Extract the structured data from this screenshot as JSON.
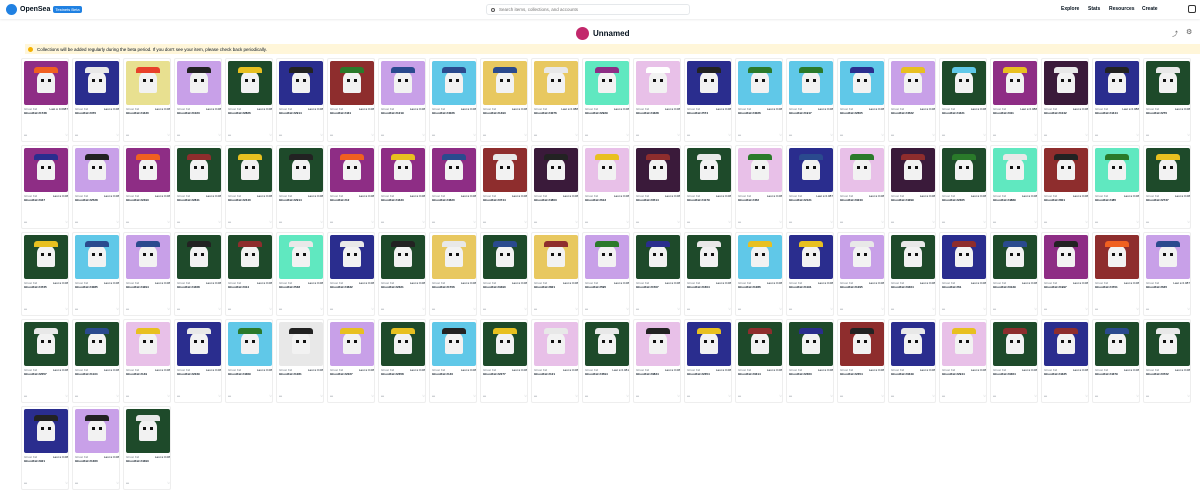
{
  "topbar": {
    "logo_text": "OpenSea",
    "beta_badge": "Testnets Beta",
    "search_placeholder": "Search items, collections, and accounts",
    "nav": [
      "Explore",
      "Stats",
      "Resources",
      "Create"
    ]
  },
  "collection": {
    "name": "Unnamed"
  },
  "notice": "Collections will be added regularly during the beta period. If you don't see your item, please check back periodically.",
  "card_label": "Ghost Kid",
  "card_price_prefix": "Last",
  "items": [
    {
      "id": "#1738",
      "price": "0.0987",
      "bg": "#8e2d85",
      "hat": "#f06020"
    },
    {
      "id": "#370",
      "price": "0.08",
      "bg": "#2a2d8e",
      "hat": "#e8e8e8"
    },
    {
      "id": "#4430",
      "price": "0.08",
      "bg": "#e8e090",
      "hat": "#e8402a"
    },
    {
      "id": "#1023",
      "price": "0.08",
      "bg": "#c8a0e8",
      "hat": "#222222"
    },
    {
      "id": "#2826",
      "price": "0.08",
      "bg": "#1e4a2a",
      "hat": "#e8c020"
    },
    {
      "id": "#2914",
      "price": "0.08",
      "bg": "#2a2d8e",
      "hat": "#222222"
    },
    {
      "id": "#431",
      "price": "0.08",
      "bg": "#8e2d2d",
      "hat": "#2a7a2a"
    },
    {
      "id": "#1219",
      "price": "0.08",
      "bg": "#c8a0e8",
      "hat": "#2a4a8e"
    },
    {
      "id": "#4026",
      "price": "0.08",
      "bg": "#60c8e8",
      "hat": "#2a4a8e"
    },
    {
      "id": "#1493",
      "price": "0.08",
      "bg": "#e8c860",
      "hat": "#2a4a8e"
    },
    {
      "id": "#4076",
      "price": "0.088",
      "bg": "#e8c860",
      "hat": "#e8e8e8"
    },
    {
      "id": "#2929",
      "price": "0.08",
      "bg": "#60e8c0",
      "hat": "#8e2d85"
    },
    {
      "id": "#4328",
      "price": "0.08",
      "bg": "#e8c0e8",
      "hat": "#ffffff"
    },
    {
      "id": "#574",
      "price": "0.08",
      "bg": "#2a2d8e",
      "hat": "#222222"
    },
    {
      "id": "#4026",
      "price": "0.08",
      "bg": "#60c8e8",
      "hat": "#2a7a2a"
    },
    {
      "id": "#1917",
      "price": "0.08",
      "bg": "#60c8e8",
      "hat": "#2a7a2a"
    },
    {
      "id": "#2605",
      "price": "0.08",
      "bg": "#60c8e8",
      "hat": "#2a2d8e"
    },
    {
      "id": "#4522",
      "price": "0.08",
      "bg": "#c8a0e8",
      "hat": "#e8c020"
    },
    {
      "id": "#4421",
      "price": "0.08",
      "bg": "#1e4a2a",
      "hat": "#60c8e8"
    },
    {
      "id": "#311",
      "price": "0.088",
      "bg": "#8e2d85",
      "hat": "#e8c020"
    },
    {
      "id": "#1042",
      "price": "0.08",
      "bg": "#3a1a3a",
      "hat": "#e8e8e8"
    },
    {
      "id": "#4444",
      "price": "0.088",
      "bg": "#2a2d8e",
      "hat": "#222222"
    },
    {
      "id": "#270",
      "price": "0.08",
      "bg": "#1e4a2a",
      "hat": "#e8e8e8"
    },
    {
      "id": "#347",
      "price": "0.08",
      "bg": "#8e2d85",
      "hat": "#2a2d8e"
    },
    {
      "id": "#2528",
      "price": "0.08",
      "bg": "#c8a0e8",
      "hat": "#222222"
    },
    {
      "id": "#2493",
      "price": "0.08",
      "bg": "#8e2d85",
      "hat": "#f06020"
    },
    {
      "id": "#2841",
      "price": "0.08",
      "bg": "#1e4a2a",
      "hat": "#8e2d2d"
    },
    {
      "id": "#2440",
      "price": "0.08",
      "bg": "#1e4a2a",
      "hat": "#e8c020"
    },
    {
      "id": "#2914",
      "price": "0.08",
      "bg": "#1e4a2a",
      "hat": "#222222"
    },
    {
      "id": "#12",
      "price": "0.08",
      "bg": "#8e2d85",
      "hat": "#f06020"
    },
    {
      "id": "#4433",
      "price": "0.08",
      "bg": "#8e2d85",
      "hat": "#e8c020"
    },
    {
      "id": "#4620",
      "price": "0.08",
      "bg": "#8e2d85",
      "hat": "#2a4a8e"
    },
    {
      "id": "#3744",
      "price": "0.08",
      "bg": "#8e2d2d",
      "hat": "#e8e8e8"
    },
    {
      "id": "#4803",
      "price": "0.08",
      "bg": "#3a1a3a",
      "hat": "#222222"
    },
    {
      "id": "#613",
      "price": "0.08",
      "bg": "#e8c0e8",
      "hat": "#e8c020"
    },
    {
      "id": "#3514",
      "price": "0.08",
      "bg": "#3a1a3a",
      "hat": "#8e2d2d"
    },
    {
      "id": "#4179",
      "price": "0.08",
      "bg": "#1e4a2a",
      "hat": "#e8e8e8"
    },
    {
      "id": "#452",
      "price": "0.08",
      "bg": "#e8c0e8",
      "hat": "#2a7a2a"
    },
    {
      "id": "#2121",
      "price": "0.087",
      "bg": "#2a2d8e",
      "hat": "#2a4a8e"
    },
    {
      "id": "#3243",
      "price": "0.08",
      "bg": "#e8c0e8",
      "hat": "#2a7a2a"
    },
    {
      "id": "#4299",
      "price": "0.08",
      "bg": "#3a1a3a",
      "hat": "#8e2d2d"
    },
    {
      "id": "#2365",
      "price": "0.08",
      "bg": "#1e4a2a",
      "hat": "#2a7a2a"
    },
    {
      "id": "#4889",
      "price": "0.08",
      "bg": "#60e8c0",
      "hat": "#e8e8e8"
    },
    {
      "id": "#801",
      "price": "0.08",
      "bg": "#8e2d2d",
      "hat": "#222222"
    },
    {
      "id": "#485",
      "price": "0.08",
      "bg": "#60e8c0",
      "hat": "#2a7a2a"
    },
    {
      "id": "#2737",
      "price": "0.08",
      "bg": "#1e4a2a",
      "hat": "#e8c020"
    },
    {
      "id": "#4735",
      "price": "0.08",
      "bg": "#1e4a2a",
      "hat": "#e8c020"
    },
    {
      "id": "#4085",
      "price": "0.08",
      "bg": "#60c8e8",
      "hat": "#2a4a8e"
    },
    {
      "id": "#4294",
      "price": "0.08",
      "bg": "#c8a0e8",
      "hat": "#2a4a8e"
    },
    {
      "id": "#4468",
      "price": "0.08",
      "bg": "#1e4a2a",
      "hat": "#222222"
    },
    {
      "id": "#314",
      "price": "0.08",
      "bg": "#1e4a2a",
      "hat": "#8e2d2d"
    },
    {
      "id": "#548",
      "price": "0.08",
      "bg": "#60e8c0",
      "hat": "#e8e8e8"
    },
    {
      "id": "#4632",
      "price": "0.08",
      "bg": "#2a2d8e",
      "hat": "#e8e8e8"
    },
    {
      "id": "#2321",
      "price": "0.08",
      "bg": "#1e4a2a",
      "hat": "#222222"
    },
    {
      "id": "#1706",
      "price": "0.08",
      "bg": "#e8c860",
      "hat": "#e8e8e8"
    },
    {
      "id": "#3490",
      "price": "0.08",
      "bg": "#1e4a2a",
      "hat": "#2a4a8e"
    },
    {
      "id": "#821",
      "price": "0.08",
      "bg": "#e8c860",
      "hat": "#8e2d2d"
    },
    {
      "id": "#595",
      "price": "0.08",
      "bg": "#c8a0e8",
      "hat": "#2a7a2a"
    },
    {
      "id": "#1507",
      "price": "0.08",
      "bg": "#1e4a2a",
      "hat": "#2a2d8e"
    },
    {
      "id": "#1604",
      "price": "0.08",
      "bg": "#1e4a2a",
      "hat": "#e8e8e8"
    },
    {
      "id": "#1286",
      "price": "0.08",
      "bg": "#60c8e8",
      "hat": "#e8c020"
    },
    {
      "id": "#1191",
      "price": "0.08",
      "bg": "#2a2d8e",
      "hat": "#e8c020"
    },
    {
      "id": "#1295",
      "price": "0.08",
      "bg": "#c8a0e8",
      "hat": "#e8e8e8"
    },
    {
      "id": "#3464",
      "price": "0.08",
      "bg": "#1e4a2a",
      "hat": "#e8e8e8"
    },
    {
      "id": "#61",
      "price": "0.08",
      "bg": "#2a2d8e",
      "hat": "#8e2d2d"
    },
    {
      "id": "#3139",
      "price": "0.08",
      "bg": "#1e4a2a",
      "hat": "#2a4a8e"
    },
    {
      "id": "#1997",
      "price": "0.08",
      "bg": "#8e2d85",
      "hat": "#222222"
    },
    {
      "id": "#4701",
      "price": "0.08",
      "bg": "#8e2d2d",
      "hat": "#f06020"
    },
    {
      "id": "#645",
      "price": "0.087",
      "bg": "#c8a0e8",
      "hat": "#2a4a8e"
    },
    {
      "id": "#2057",
      "price": "0.08",
      "bg": "#1e4a2a",
      "hat": "#e8e8e8"
    },
    {
      "id": "#1134",
      "price": "0.08",
      "bg": "#1e4a2a",
      "hat": "#2a4a8e"
    },
    {
      "id": "#149",
      "price": "0.08",
      "bg": "#e8c0e8",
      "hat": "#e8c020"
    },
    {
      "id": "#2239",
      "price": "0.08",
      "bg": "#2a2d8e",
      "hat": "#e8e8e8"
    },
    {
      "id": "#4369",
      "price": "0.08",
      "bg": "#60c8e8",
      "hat": "#2a7a2a"
    },
    {
      "id": "#1281",
      "price": "0.08",
      "bg": "#e8e8e8",
      "hat": "#222222"
    },
    {
      "id": "#2227",
      "price": "0.08",
      "bg": "#c8a0e8",
      "hat": "#e8c020"
    },
    {
      "id": "#2358",
      "price": "0.08",
      "bg": "#1e4a2a",
      "hat": "#e8c020"
    },
    {
      "id": "#140",
      "price": "0.08",
      "bg": "#60c8e8",
      "hat": "#222222"
    },
    {
      "id": "#2277",
      "price": "0.08",
      "bg": "#1e4a2a",
      "hat": "#e8c020"
    },
    {
      "id": "#121",
      "price": "0.08",
      "bg": "#e8c0e8",
      "hat": "#e8e8e8"
    },
    {
      "id": "#4594",
      "price": "0.081",
      "bg": "#1e4a2a",
      "hat": "#e8e8e8"
    },
    {
      "id": "#3834",
      "price": "0.08",
      "bg": "#e8c0e8",
      "hat": "#222222"
    },
    {
      "id": "#2354",
      "price": "0.08",
      "bg": "#2a2d8e",
      "hat": "#e8c020"
    },
    {
      "id": "#3314",
      "price": "0.08",
      "bg": "#1e4a2a",
      "hat": "#8e2d2d"
    },
    {
      "id": "#2363",
      "price": "0.08",
      "bg": "#1e4a2a",
      "hat": "#2a2d8e"
    },
    {
      "id": "#2354",
      "price": "0.08",
      "bg": "#8e2d2d",
      "hat": "#222222"
    },
    {
      "id": "#3349",
      "price": "0.08",
      "bg": "#2a2d8e",
      "hat": "#e8e8e8"
    },
    {
      "id": "#2944",
      "price": "0.08",
      "bg": "#e8c0e8",
      "hat": "#e8c020"
    },
    {
      "id": "#3364",
      "price": "0.08",
      "bg": "#1e4a2a",
      "hat": "#8e2d2d"
    },
    {
      "id": "#4335",
      "price": "0.08",
      "bg": "#2a2d8e",
      "hat": "#8e2d2d"
    },
    {
      "id": "#4379",
      "price": "0.08",
      "bg": "#1e4a2a",
      "hat": "#2a4a8e"
    },
    {
      "id": "#3722",
      "price": "0.08",
      "bg": "#1e4a2a",
      "hat": "#e8e8e8"
    },
    {
      "id": "#921",
      "price": "0.08",
      "bg": "#2a2d8e",
      "hat": "#222222"
    },
    {
      "id": "#1360",
      "price": "0.08",
      "bg": "#c8a0e8",
      "hat": "#222222"
    },
    {
      "id": "#4393",
      "price": "0.08",
      "bg": "#1e4a2a",
      "hat": "#e8e8e8"
    }
  ]
}
